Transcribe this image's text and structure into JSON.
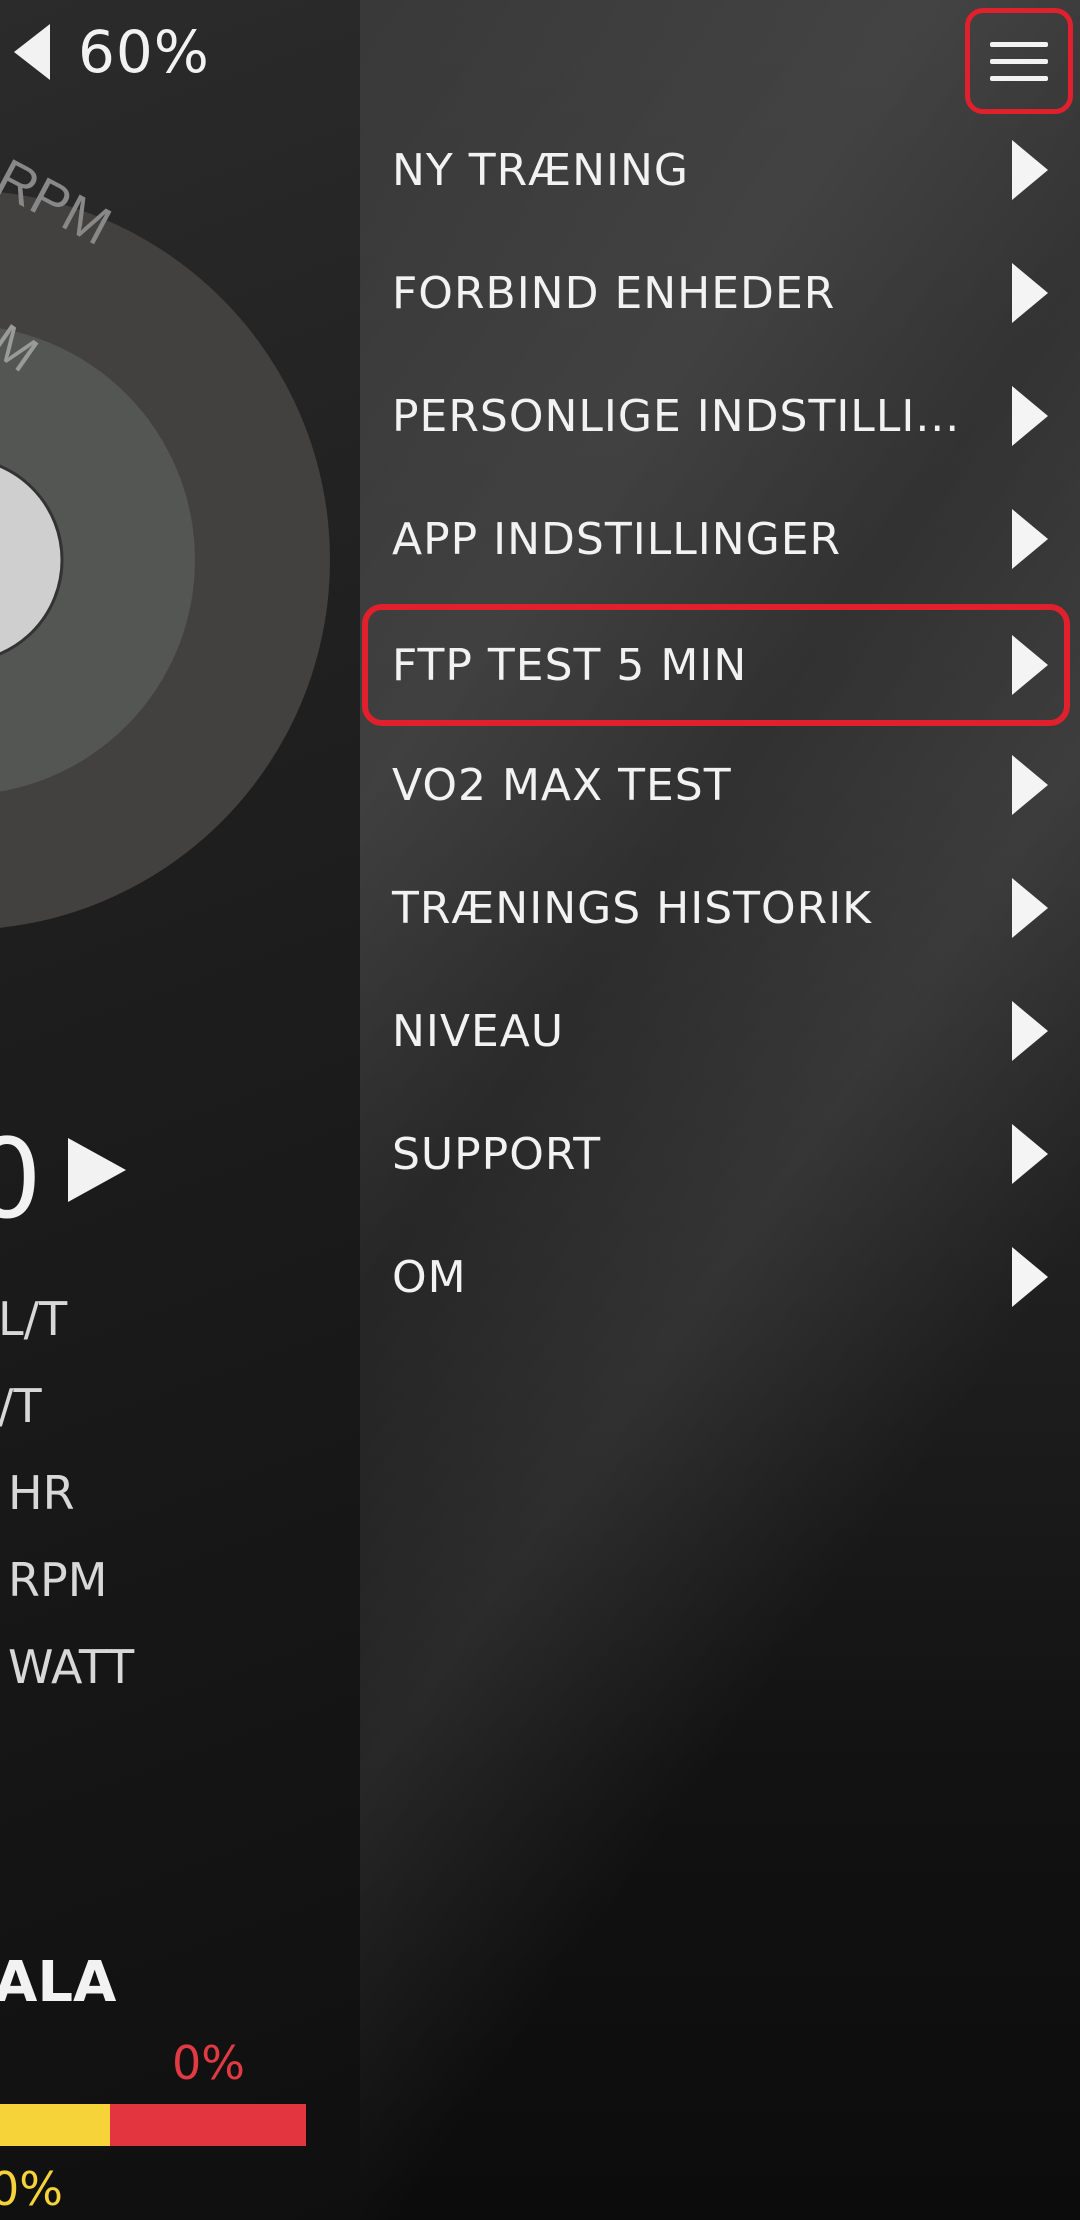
{
  "status": {
    "battery_percent": "60%"
  },
  "gauge": {
    "outer_label": "RPM",
    "middle_label": "M"
  },
  "metrics": {
    "big_value": "0",
    "stats": [
      "L/T",
      "/T",
      "HR",
      "RPM",
      "WATT"
    ]
  },
  "scale": {
    "title": "ALA",
    "top_percent": "0%",
    "bottom_percent": "0%",
    "colors": {
      "yellow": "#f7d33a",
      "red": "#e2353f"
    }
  },
  "menu": {
    "items": [
      {
        "label": "NY TRÆNING"
      },
      {
        "label": "FORBIND ENHEDER"
      },
      {
        "label": "PERSONLIGE INDSTILLI..."
      },
      {
        "label": "APP INDSTILLINGER"
      },
      {
        "label": "FTP TEST 5 MIN",
        "highlighted": true
      },
      {
        "label": "VO2 MAX TEST"
      },
      {
        "label": "TRÆNINGS HISTORIK"
      },
      {
        "label": "NIVEAU"
      },
      {
        "label": "SUPPORT"
      },
      {
        "label": "OM"
      }
    ],
    "highlight_color": "#e0202c"
  }
}
